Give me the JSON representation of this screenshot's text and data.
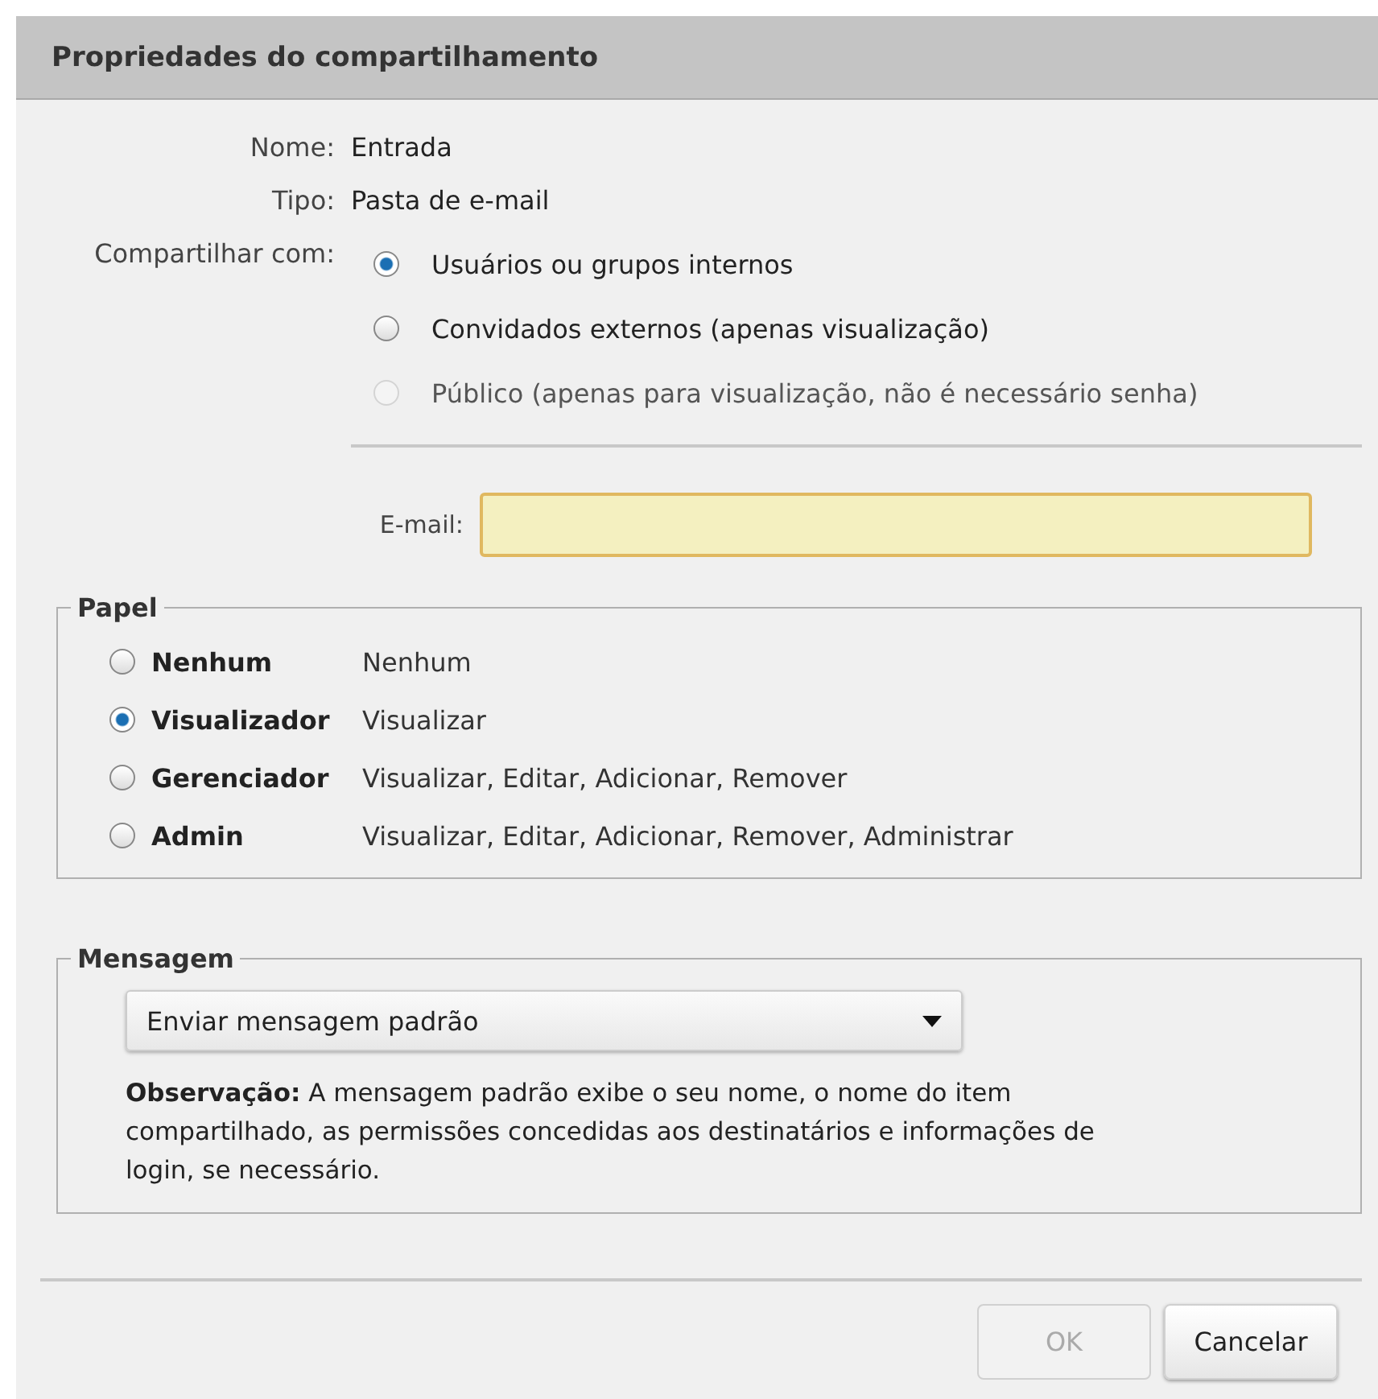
{
  "window": {
    "title": "Propriedades do compartilhamento"
  },
  "info": [
    {
      "label": "Nome:",
      "value": "Entrada"
    },
    {
      "label": "Tipo:",
      "value": "Pasta de e-mail"
    }
  ],
  "share_with": {
    "label": "Compartilhar com:",
    "options": [
      {
        "label": "Usuários ou grupos internos",
        "selected": true,
        "disabled": false
      },
      {
        "label": "Convidados externos (apenas visualização)",
        "selected": false,
        "disabled": false
      },
      {
        "label": "Público (apenas para visualização, não é necessário senha)",
        "selected": false,
        "disabled": true
      }
    ]
  },
  "email": {
    "label": "E-mail:"
  },
  "role": {
    "title": "Papel",
    "options": [
      {
        "name": "Nenhum",
        "permissions": "Nenhum",
        "selected": false
      },
      {
        "name": "Visualizador",
        "permissions": "Visualizar",
        "selected": true
      },
      {
        "name": "Gerenciador",
        "permissions": "Visualizar, Editar, Adicionar, Remover",
        "selected": false
      },
      {
        "name": "Admin",
        "permissions": "Visualizar, Editar, Adicionar, Remover, Administrar",
        "selected": false
      }
    ]
  },
  "message": {
    "title": "Mensagem",
    "dropdown": "Enviar mensagem padrão",
    "note": "**Observação:** A mensagem padrão exibe o seu nome, o nome do item compartilhado, as permissões concedidas aos destinatários e informações de login, se necessário."
  },
  "buttons": [
    {
      "label": "OK",
      "disabled": true
    },
    {
      "label": "Cancelar",
      "disabled": false
    }
  ]
}
